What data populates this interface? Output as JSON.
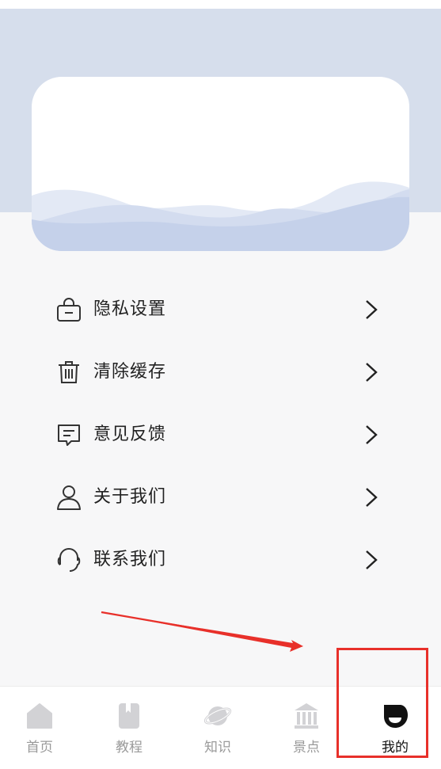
{
  "menu": {
    "items": [
      {
        "label": "隐私设置",
        "icon": "lock-bag-icon"
      },
      {
        "label": "清除缓存",
        "icon": "trash-icon"
      },
      {
        "label": "意见反馈",
        "icon": "feedback-message-icon"
      },
      {
        "label": "关于我们",
        "icon": "user-icon"
      },
      {
        "label": "联系我们",
        "icon": "headset-icon"
      }
    ]
  },
  "tabbar": {
    "tabs": [
      {
        "label": "首页",
        "icon": "home-icon",
        "active": false
      },
      {
        "label": "教程",
        "icon": "book-icon",
        "active": false
      },
      {
        "label": "知识",
        "icon": "planet-icon",
        "active": false
      },
      {
        "label": "景点",
        "icon": "temple-icon",
        "active": false
      },
      {
        "label": "我的",
        "icon": "profile-icon",
        "active": true
      }
    ]
  },
  "colors": {
    "header_bg": "#d6deec",
    "wave_light": "#e3e9f5",
    "wave_dark": "#c5d1ea",
    "annotation_red": "#e8302a",
    "tab_inactive": "#cfcfd2",
    "tab_active": "#111111"
  }
}
